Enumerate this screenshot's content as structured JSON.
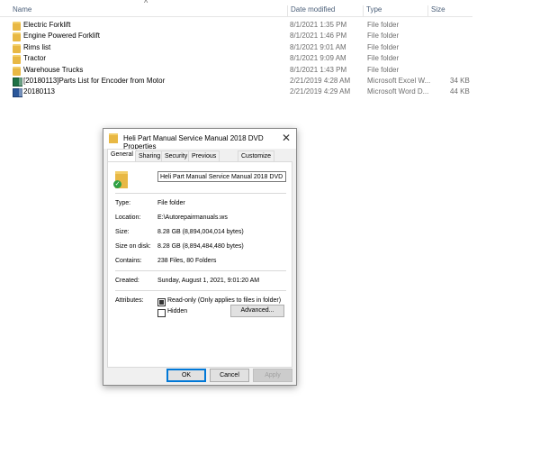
{
  "columns": {
    "name": "Name",
    "date": "Date modified",
    "type": "Type",
    "size": "Size",
    "sort_glyph": "^"
  },
  "files": [
    {
      "name": "Electric Forklift",
      "date": "8/1/2021 1:35 PM",
      "type": "File folder",
      "size": "",
      "icon": "folder-icon"
    },
    {
      "name": "Engine Powered Forklift",
      "date": "8/1/2021 1:46 PM",
      "type": "File folder",
      "size": "",
      "icon": "folder-icon"
    },
    {
      "name": "Rims list",
      "date": "8/1/2021 9:01 AM",
      "type": "File folder",
      "size": "",
      "icon": "folder-icon"
    },
    {
      "name": "Tractor",
      "date": "8/1/2021 9:09 AM",
      "type": "File folder",
      "size": "",
      "icon": "folder-icon"
    },
    {
      "name": "Warehouse Trucks",
      "date": "8/1/2021 1:43 PM",
      "type": "File folder",
      "size": "",
      "icon": "folder-icon"
    },
    {
      "name": "[20180113]Parts List for Encoder from Motor",
      "date": "2/21/2019 4:28 AM",
      "type": "Microsoft Excel W...",
      "size": "34 KB",
      "icon": "excel-file-icon"
    },
    {
      "name": "20180113",
      "date": "2/21/2019 4:29 AM",
      "type": "Microsoft Word D...",
      "size": "44 KB",
      "icon": "word-file-icon"
    }
  ],
  "dialog": {
    "title": "Heli Part Manual Service Manual 2018 DVD Properties",
    "close_glyph": "✕",
    "tabs": [
      "General",
      "Sharing",
      "Security",
      "Previous Versions",
      "Customize"
    ],
    "folder_name": "Heli Part Manual Service Manual 2018 DVD",
    "check_glyph": "✓",
    "props": {
      "type_label": "Type:",
      "type_value": "File folder",
      "location_label": "Location:",
      "location_value": "E:\\Autorepairmanuals.ws",
      "size_label": "Size:",
      "size_value": "8.28 GB (8,894,004,014 bytes)",
      "size_on_disk_label": "Size on disk:",
      "size_on_disk_value": "8.28 GB (8,894,484,480 bytes)",
      "contains_label": "Contains:",
      "contains_value": "238 Files, 80 Folders",
      "created_label": "Created:",
      "created_value": "Sunday, August 1, 2021, 9:01:20 AM",
      "attributes_label": "Attributes:"
    },
    "attributes": {
      "readonly_label": "Read-only (Only applies to files in folder)",
      "readonly_checked": true,
      "hidden_label": "Hidden",
      "hidden_checked": false,
      "advanced_label": "Advanced..."
    },
    "buttons": {
      "ok": "OK",
      "cancel": "Cancel",
      "apply": "Apply"
    }
  }
}
